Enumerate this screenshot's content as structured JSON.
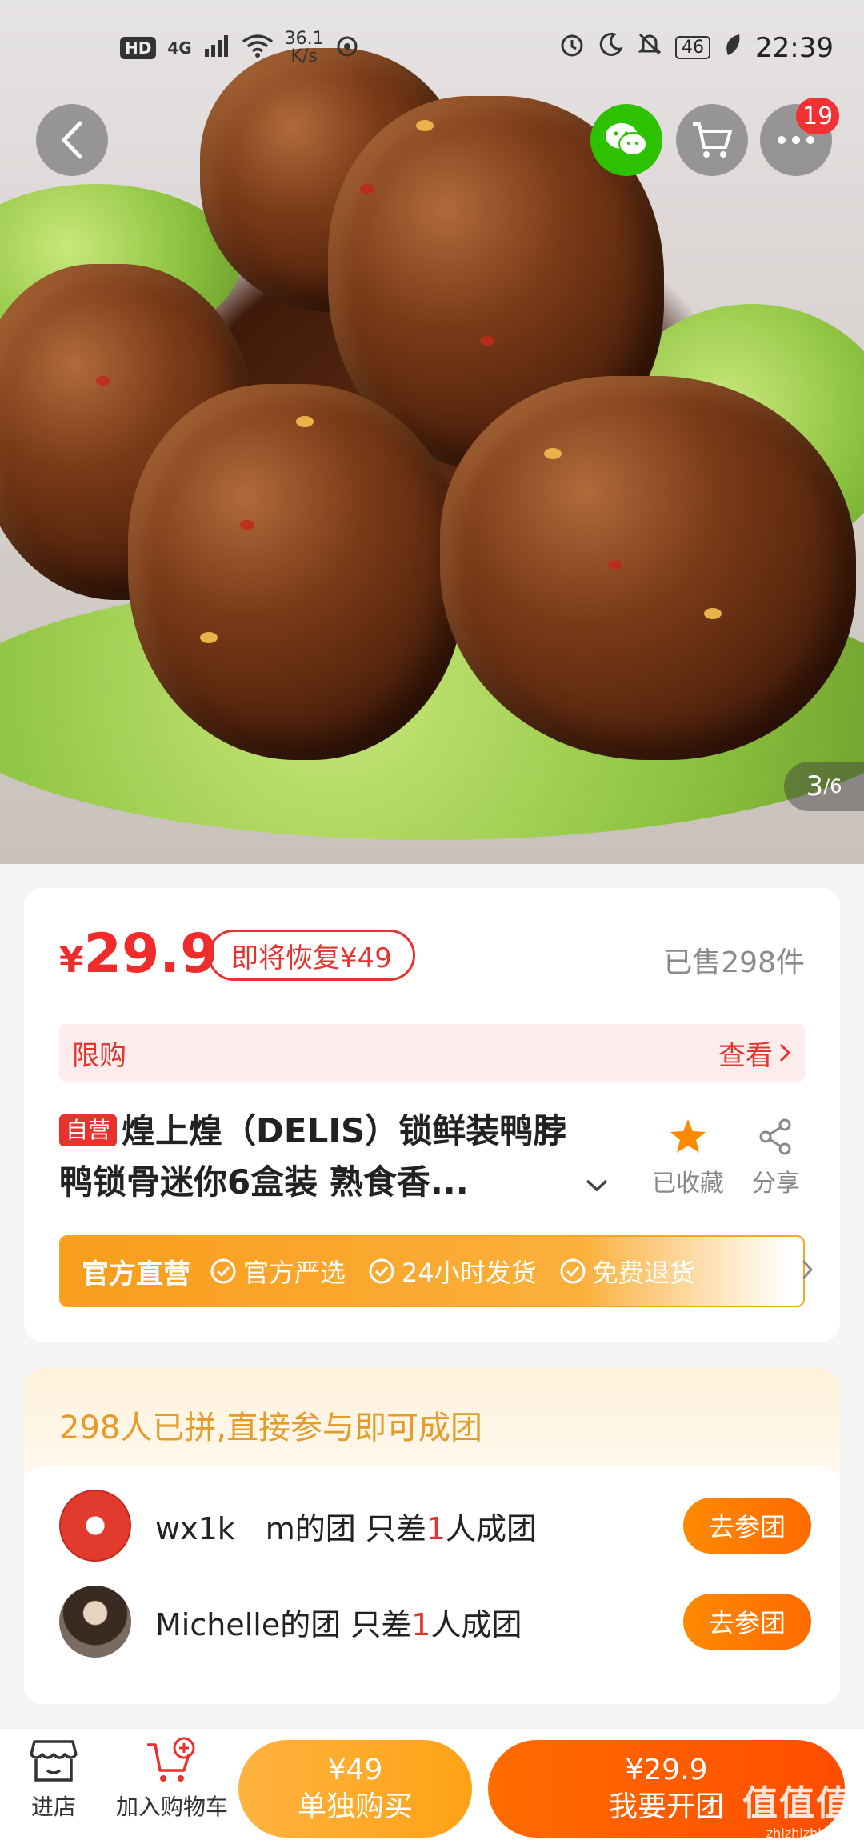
{
  "status_bar": {
    "hd": "HD",
    "network": "4G",
    "speed_value": "36.1",
    "speed_unit": "K/s",
    "battery": "46",
    "time": "22:39"
  },
  "header": {
    "more_badge": "19"
  },
  "gallery": {
    "current": "3",
    "total": "/6"
  },
  "product": {
    "price_symbol": "¥",
    "price": "29.9",
    "restore_tag": "即将恢复¥49",
    "sold": "已售298件",
    "limit_label": "限购",
    "limit_view": "查看",
    "self_tag": "自营",
    "title": "煌上煌（DELIS）锁鲜装鸭脖鸭锁骨迷你6盒装 熟食香...",
    "favorite_label": "已收藏",
    "share_label": "分享",
    "official": {
      "main": "官方直营",
      "items": [
        "官方严选",
        "24小时发货",
        "免费退货"
      ]
    }
  },
  "group": {
    "headline": "298人已拼,直接参与即可成团",
    "rows": [
      {
        "name": "wx1k　m的团 只差",
        "num": "1",
        "suffix": "人成团",
        "button": "去参团"
      },
      {
        "name": "Michelle的团 只差",
        "num": "1",
        "suffix": "人成团",
        "button": "去参团"
      }
    ]
  },
  "bottom_bar": {
    "store_label": "进店",
    "cart_label": "加入购物车",
    "single_price": "¥49",
    "single_label": "单独购买",
    "group_price": "¥29.9",
    "group_label": "我要开团"
  },
  "watermark": {
    "text": "值值值",
    "sub": "zhizhizhi.com"
  },
  "colors": {
    "accent_red": "#e8322e",
    "accent_orange": "#ff6a00",
    "gold": "#e59b2a",
    "wechat_green": "#2dc100"
  },
  "icons": [
    "back-icon",
    "wechat-icon",
    "cart-icon",
    "more-icon",
    "star-icon",
    "share-icon",
    "chevron-down-icon",
    "check-circle-icon",
    "store-icon",
    "add-cart-icon"
  ]
}
